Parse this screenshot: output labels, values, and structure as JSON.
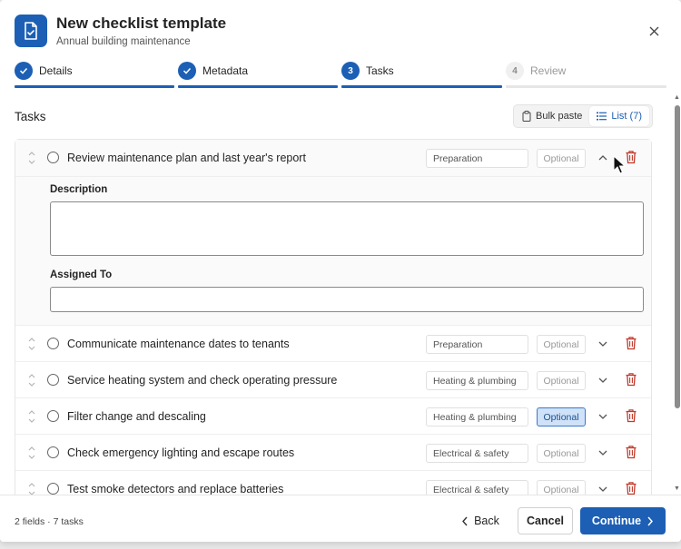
{
  "header": {
    "title": "New checklist template",
    "subtitle": "Annual building maintenance"
  },
  "stepper": [
    {
      "num": "1",
      "label": "Details",
      "state": "done"
    },
    {
      "num": "2",
      "label": "Metadata",
      "state": "done"
    },
    {
      "num": "3",
      "label": "Tasks",
      "state": "current"
    },
    {
      "num": "4",
      "label": "Review",
      "state": "upcoming"
    }
  ],
  "tasks_section": {
    "title": "Tasks",
    "bulk_paste_label": "Bulk paste",
    "list_label": "List (7)"
  },
  "expanded_fields": {
    "description_label": "Description",
    "assigned_label": "Assigned To",
    "description_value": "",
    "assigned_value": ""
  },
  "tasks": [
    {
      "text": "Review maintenance plan and last year's report",
      "category": "Preparation",
      "optional": "Optional",
      "optional_on": false,
      "expanded": true
    },
    {
      "text": "Communicate maintenance dates to tenants",
      "category": "Preparation",
      "optional": "Optional",
      "optional_on": false,
      "expanded": false
    },
    {
      "text": "Service heating system and check operating pressure",
      "category": "Heating & plumbing",
      "optional": "Optional",
      "optional_on": false,
      "expanded": false
    },
    {
      "text": "Filter change and descaling",
      "category": "Heating & plumbing",
      "optional": "Optional",
      "optional_on": true,
      "expanded": false
    },
    {
      "text": "Check emergency lighting and escape routes",
      "category": "Electrical & safety",
      "optional": "Optional",
      "optional_on": false,
      "expanded": false
    },
    {
      "text": "Test smoke detectors and replace batteries",
      "category": "Electrical & safety",
      "optional": "Optional",
      "optional_on": false,
      "expanded": false
    }
  ],
  "footer": {
    "status": "2 fields · 7 tasks",
    "back_label": "Back",
    "cancel_label": "Cancel",
    "continue_label": "Continue"
  },
  "colors": {
    "accent": "#1c5fb5",
    "danger": "#c0392b",
    "optional_on_bg": "#cfe2f8"
  },
  "icons": {
    "app": "document-checklist-icon",
    "close": "close-icon",
    "drag": "drag-handle-icon",
    "delete": "trash-icon",
    "bulk_paste": "clipboard-icon",
    "list": "list-icon"
  }
}
